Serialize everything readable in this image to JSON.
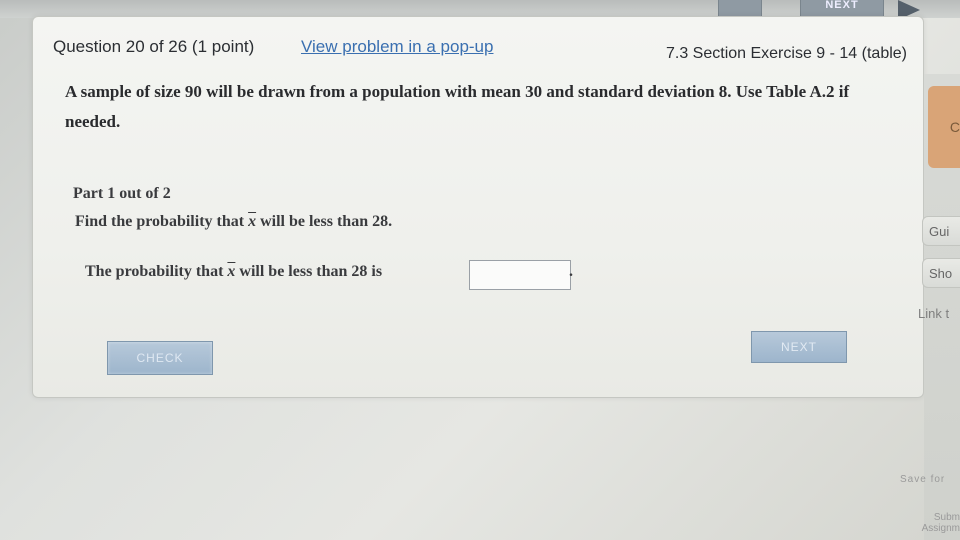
{
  "top": {
    "next_label": "NEXT"
  },
  "header": {
    "question_title": "Question 20 of 26 (1 point)",
    "popup_link": "View problem in a pop-up",
    "section": "7.3 Section Exercise 9 - 14 (table)"
  },
  "problem": {
    "text": "A sample of size 90 will be drawn from a population with mean 30 and standard deviation 8. Use Table A.2 if needed."
  },
  "part": {
    "title": "Part 1 out of 2",
    "question_prefix": "Find the probability that",
    "question_var": "x",
    "question_suffix": "will be less than 28."
  },
  "answer": {
    "prefix": "The probability that",
    "var": "x",
    "suffix": "will be less than 28 is",
    "value": "",
    "end": "."
  },
  "buttons": {
    "check": "CHECK",
    "next": "NEXT"
  },
  "sidebar": {
    "orange_label": "C",
    "guide": "Gui",
    "show": "Sho",
    "link": "Link t",
    "save": "Save for",
    "submit_1": "Subm",
    "submit_2": "Assignm"
  }
}
